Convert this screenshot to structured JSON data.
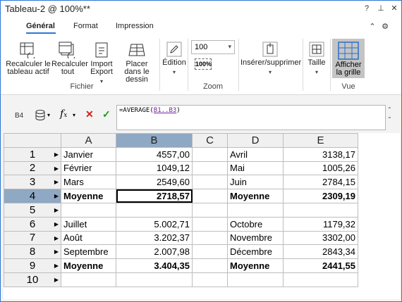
{
  "window": {
    "title": "Tableau-2 @ 100%**",
    "help": "?",
    "pin": "⊥",
    "close": "✕"
  },
  "tabs": [
    {
      "label": "Général",
      "active": true
    },
    {
      "label": "Format",
      "active": false
    },
    {
      "label": "Impression",
      "active": false
    }
  ],
  "tab_controls": {
    "collapse": "⌃",
    "settings": "⚙"
  },
  "ribbon": {
    "fichier": {
      "recalc_active": "Recalculer le tableau actif",
      "recalc_all": "Recalculer tout",
      "import_export": "Import Export",
      "place_drawing": "Placer dans le dessin",
      "group_label": "Fichier"
    },
    "edition": {
      "label": "Édition"
    },
    "zoom": {
      "value": "100",
      "zoom100": "100%",
      "group_label": "Zoom"
    },
    "insert_delete": {
      "label": "Insérer/supprimer"
    },
    "size": {
      "label": "Taille"
    },
    "vue": {
      "show_grid": "Afficher la grille",
      "group_label": "Vue"
    }
  },
  "formula": {
    "cell_ref": "B4",
    "func_prefix": "=AVERAGE(",
    "func_ref": "B1..B3",
    "func_suffix": ")"
  },
  "sheet": {
    "columns": [
      "A",
      "B",
      "C",
      "D",
      "E"
    ],
    "selected_column": "B",
    "selected_row": 4,
    "rows": [
      {
        "n": "1",
        "a": "Janvier",
        "b": "4557,00",
        "c": "",
        "d": "Avril",
        "e": "3138,17",
        "bold": false
      },
      {
        "n": "2",
        "a": "Février",
        "b": "1049,12",
        "c": "",
        "d": "Mai",
        "e": "1005,26",
        "bold": false
      },
      {
        "n": "3",
        "a": "Mars",
        "b": "2549,60",
        "c": "",
        "d": "Juin",
        "e": "2784,15",
        "bold": false
      },
      {
        "n": "4",
        "a": "Moyenne",
        "b": "2718,57",
        "c": "",
        "d": "Moyenne",
        "e": "2309,19",
        "bold": true
      },
      {
        "n": "5",
        "a": "",
        "b": "",
        "c": "",
        "d": "",
        "e": "",
        "bold": false
      },
      {
        "n": "6",
        "a": "Juillet",
        "b": "5.002,71",
        "c": "",
        "d": "Octobre",
        "e": "1179,32",
        "bold": false
      },
      {
        "n": "7",
        "a": "Août",
        "b": "3.202,37",
        "c": "",
        "d": "Novembre",
        "e": "3302,00",
        "bold": false
      },
      {
        "n": "8",
        "a": "Septembre",
        "b": "2.007,98",
        "c": "",
        "d": "Décembre",
        "e": "2843,34",
        "bold": false
      },
      {
        "n": "9",
        "a": "Moyenne",
        "b": "3.404,35",
        "c": "",
        "d": "Moyenne",
        "e": "2441,55",
        "bold": true
      },
      {
        "n": "10",
        "a": "",
        "b": "",
        "c": "",
        "d": "",
        "e": "",
        "bold": false
      }
    ]
  }
}
